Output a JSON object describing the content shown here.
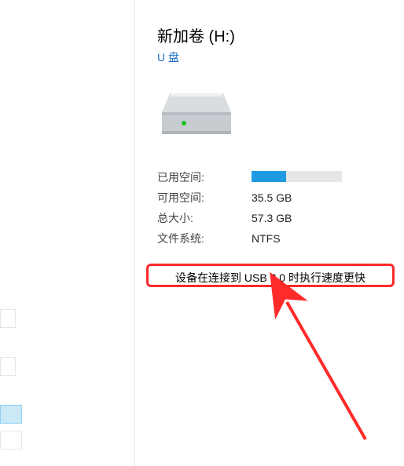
{
  "drive": {
    "title": "新加卷 (H:)",
    "subtitle": "U 盘"
  },
  "stats": {
    "used_label": "已用空间:",
    "free_label": "可用空间:",
    "free_value": "35.5 GB",
    "total_label": "总大小:",
    "total_value": "57.3 GB",
    "fs_label": "文件系统:",
    "fs_value": "NTFS",
    "used_percent": 38
  },
  "usb_notice": "设备在连接到 USB 3.0 时执行速度更快",
  "icon_names": {
    "drive": "drive-icon"
  }
}
